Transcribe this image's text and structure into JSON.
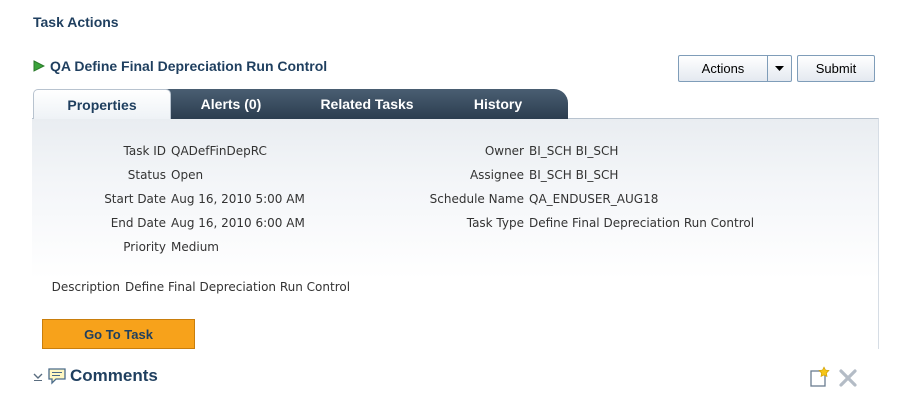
{
  "page": {
    "title": "Task Actions"
  },
  "task": {
    "name": "QA Define Final Depreciation Run Control",
    "actions_label": "Actions",
    "submit_label": "Submit"
  },
  "tabs": [
    {
      "label": "Properties",
      "selected": true
    },
    {
      "label": "Alerts (0)",
      "selected": false
    },
    {
      "label": "Related Tasks",
      "selected": false
    },
    {
      "label": "History",
      "selected": false
    }
  ],
  "properties": {
    "left": [
      {
        "label": "Task ID",
        "value": "QADefFinDepRC"
      },
      {
        "label": "Status",
        "value": "Open"
      },
      {
        "label": "Start Date",
        "value": "Aug 16, 2010 5:00 AM"
      },
      {
        "label": "End Date",
        "value": "Aug 16, 2010 6:00 AM"
      },
      {
        "label": "Priority",
        "value": "Medium"
      }
    ],
    "right": [
      {
        "label": "Owner",
        "value": "BI_SCH BI_SCH"
      },
      {
        "label": "Assignee",
        "value": "BI_SCH BI_SCH"
      },
      {
        "label": "Schedule Name",
        "value": "QA_ENDUSER_AUG18"
      },
      {
        "label": "Task Type",
        "value": "Define Final Depreciation Run Control"
      }
    ],
    "description": {
      "label": "Description",
      "value": "Define Final Depreciation Run Control"
    }
  },
  "go_to_task_label": "Go To Task",
  "comments": {
    "title": "Comments"
  },
  "icons": {
    "play": "play-icon",
    "dropdown": "caret-down-icon",
    "disclosure": "disclosure-expanded-icon",
    "comment": "comment-bubble-icon",
    "new_comment": "new-comment-icon",
    "delete": "delete-icon"
  },
  "colors": {
    "heading": "#1f3f5f",
    "play_icon": "#3aa33a",
    "tab_dark": "#3b4d60",
    "go_button": "#f7a21b"
  }
}
